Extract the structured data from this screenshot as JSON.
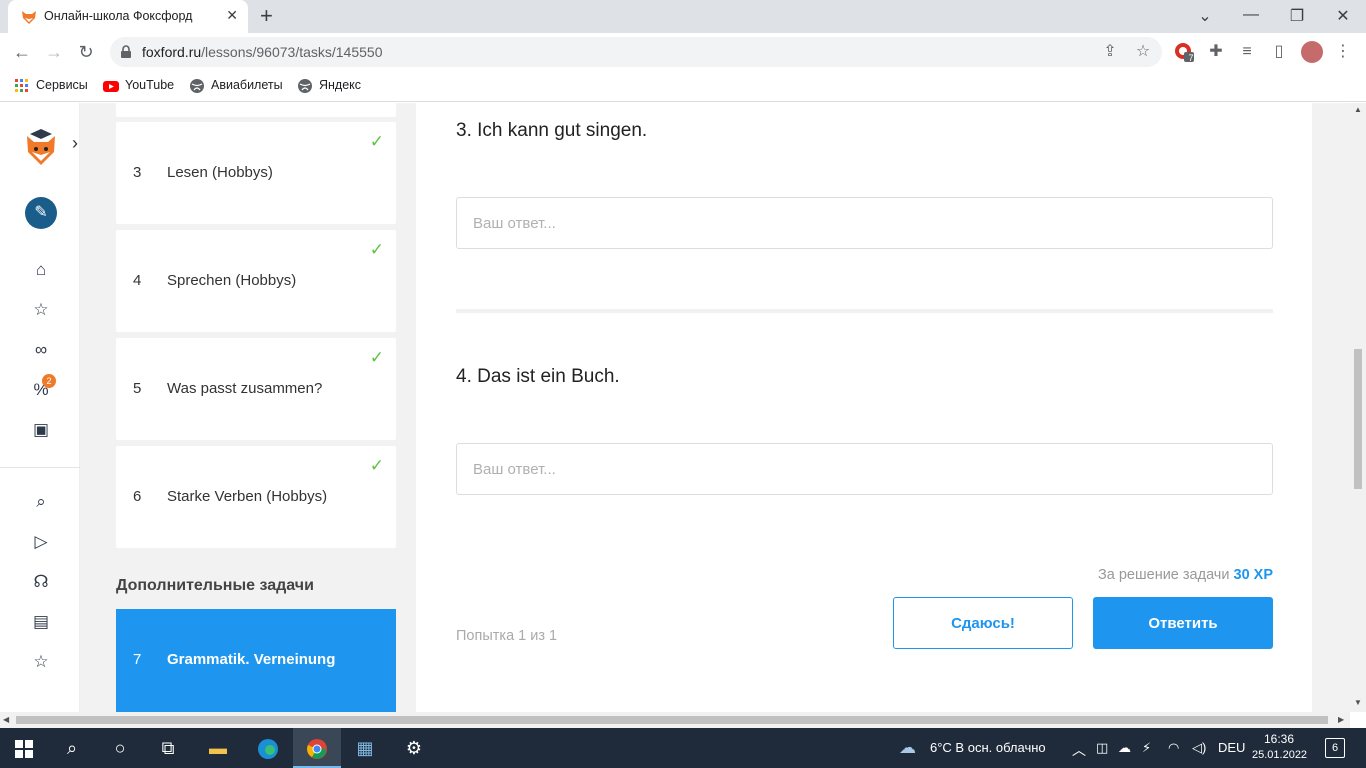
{
  "browser": {
    "tab_title": "Онлайн-школа Фоксфорд",
    "url_host": "foxford.ru",
    "url_path": "/lessons/96073/tasks/145550",
    "extension_badge": "7",
    "bookmarks": [
      "Сервисы",
      "YouTube",
      "Авиабилеты",
      "Яндекс"
    ]
  },
  "rail": {
    "promo_badge": "2"
  },
  "tasks": [
    {
      "num": "3",
      "label": "Lesen (Hobbys)",
      "done": true
    },
    {
      "num": "4",
      "label": "Sprechen (Hobbys)",
      "done": true
    },
    {
      "num": "5",
      "label": "Was passt zusammen?",
      "done": true
    },
    {
      "num": "6",
      "label": "Starke Verben (Hobbys)",
      "done": true
    }
  ],
  "extra": {
    "title": "Дополнительные задачи",
    "active_num": "7",
    "active_label": "Grammatik. Verneinung"
  },
  "content": {
    "q3": "3. Ich kann gut singen.",
    "q4": "4. Das ist ein Buch.",
    "answer_placeholder": "Ваш ответ...",
    "xp_text": "За решение задачи",
    "xp_value": "30 XP",
    "attempt": "Попытка 1 из 1",
    "giveup_label": "Сдаюсь!",
    "submit_label": "Ответить"
  },
  "colors": {
    "accent": "#1e96f0",
    "check": "#5fc23f"
  },
  "taskbar": {
    "weather": "6°C  В осн. облачно",
    "lang": "DEU",
    "time": "16:36",
    "date": "25.01.2022",
    "notifications": "6"
  }
}
